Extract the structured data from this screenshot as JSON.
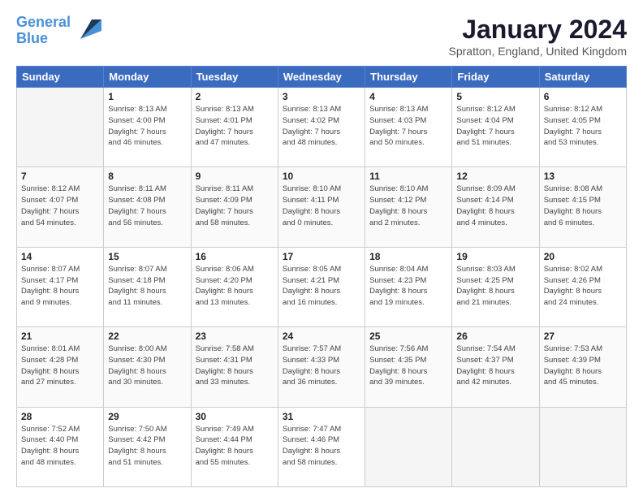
{
  "header": {
    "logo_line1": "General",
    "logo_line2": "Blue",
    "month_year": "January 2024",
    "location": "Spratton, England, United Kingdom"
  },
  "weekdays": [
    "Sunday",
    "Monday",
    "Tuesday",
    "Wednesday",
    "Thursday",
    "Friday",
    "Saturday"
  ],
  "weeks": [
    [
      {
        "day": "",
        "text": ""
      },
      {
        "day": "1",
        "text": "Sunrise: 8:13 AM\nSunset: 4:00 PM\nDaylight: 7 hours\nand 46 minutes."
      },
      {
        "day": "2",
        "text": "Sunrise: 8:13 AM\nSunset: 4:01 PM\nDaylight: 7 hours\nand 47 minutes."
      },
      {
        "day": "3",
        "text": "Sunrise: 8:13 AM\nSunset: 4:02 PM\nDaylight: 7 hours\nand 48 minutes."
      },
      {
        "day": "4",
        "text": "Sunrise: 8:13 AM\nSunset: 4:03 PM\nDaylight: 7 hours\nand 50 minutes."
      },
      {
        "day": "5",
        "text": "Sunrise: 8:12 AM\nSunset: 4:04 PM\nDaylight: 7 hours\nand 51 minutes."
      },
      {
        "day": "6",
        "text": "Sunrise: 8:12 AM\nSunset: 4:05 PM\nDaylight: 7 hours\nand 53 minutes."
      }
    ],
    [
      {
        "day": "7",
        "text": "Sunrise: 8:12 AM\nSunset: 4:07 PM\nDaylight: 7 hours\nand 54 minutes."
      },
      {
        "day": "8",
        "text": "Sunrise: 8:11 AM\nSunset: 4:08 PM\nDaylight: 7 hours\nand 56 minutes."
      },
      {
        "day": "9",
        "text": "Sunrise: 8:11 AM\nSunset: 4:09 PM\nDaylight: 7 hours\nand 58 minutes."
      },
      {
        "day": "10",
        "text": "Sunrise: 8:10 AM\nSunset: 4:11 PM\nDaylight: 8 hours\nand 0 minutes."
      },
      {
        "day": "11",
        "text": "Sunrise: 8:10 AM\nSunset: 4:12 PM\nDaylight: 8 hours\nand 2 minutes."
      },
      {
        "day": "12",
        "text": "Sunrise: 8:09 AM\nSunset: 4:14 PM\nDaylight: 8 hours\nand 4 minutes."
      },
      {
        "day": "13",
        "text": "Sunrise: 8:08 AM\nSunset: 4:15 PM\nDaylight: 8 hours\nand 6 minutes."
      }
    ],
    [
      {
        "day": "14",
        "text": "Sunrise: 8:07 AM\nSunset: 4:17 PM\nDaylight: 8 hours\nand 9 minutes."
      },
      {
        "day": "15",
        "text": "Sunrise: 8:07 AM\nSunset: 4:18 PM\nDaylight: 8 hours\nand 11 minutes."
      },
      {
        "day": "16",
        "text": "Sunrise: 8:06 AM\nSunset: 4:20 PM\nDaylight: 8 hours\nand 13 minutes."
      },
      {
        "day": "17",
        "text": "Sunrise: 8:05 AM\nSunset: 4:21 PM\nDaylight: 8 hours\nand 16 minutes."
      },
      {
        "day": "18",
        "text": "Sunrise: 8:04 AM\nSunset: 4:23 PM\nDaylight: 8 hours\nand 19 minutes."
      },
      {
        "day": "19",
        "text": "Sunrise: 8:03 AM\nSunset: 4:25 PM\nDaylight: 8 hours\nand 21 minutes."
      },
      {
        "day": "20",
        "text": "Sunrise: 8:02 AM\nSunset: 4:26 PM\nDaylight: 8 hours\nand 24 minutes."
      }
    ],
    [
      {
        "day": "21",
        "text": "Sunrise: 8:01 AM\nSunset: 4:28 PM\nDaylight: 8 hours\nand 27 minutes."
      },
      {
        "day": "22",
        "text": "Sunrise: 8:00 AM\nSunset: 4:30 PM\nDaylight: 8 hours\nand 30 minutes."
      },
      {
        "day": "23",
        "text": "Sunrise: 7:58 AM\nSunset: 4:31 PM\nDaylight: 8 hours\nand 33 minutes."
      },
      {
        "day": "24",
        "text": "Sunrise: 7:57 AM\nSunset: 4:33 PM\nDaylight: 8 hours\nand 36 minutes."
      },
      {
        "day": "25",
        "text": "Sunrise: 7:56 AM\nSunset: 4:35 PM\nDaylight: 8 hours\nand 39 minutes."
      },
      {
        "day": "26",
        "text": "Sunrise: 7:54 AM\nSunset: 4:37 PM\nDaylight: 8 hours\nand 42 minutes."
      },
      {
        "day": "27",
        "text": "Sunrise: 7:53 AM\nSunset: 4:39 PM\nDaylight: 8 hours\nand 45 minutes."
      }
    ],
    [
      {
        "day": "28",
        "text": "Sunrise: 7:52 AM\nSunset: 4:40 PM\nDaylight: 8 hours\nand 48 minutes."
      },
      {
        "day": "29",
        "text": "Sunrise: 7:50 AM\nSunset: 4:42 PM\nDaylight: 8 hours\nand 51 minutes."
      },
      {
        "day": "30",
        "text": "Sunrise: 7:49 AM\nSunset: 4:44 PM\nDaylight: 8 hours\nand 55 minutes."
      },
      {
        "day": "31",
        "text": "Sunrise: 7:47 AM\nSunset: 4:46 PM\nDaylight: 8 hours\nand 58 minutes."
      },
      {
        "day": "",
        "text": ""
      },
      {
        "day": "",
        "text": ""
      },
      {
        "day": "",
        "text": ""
      }
    ]
  ]
}
